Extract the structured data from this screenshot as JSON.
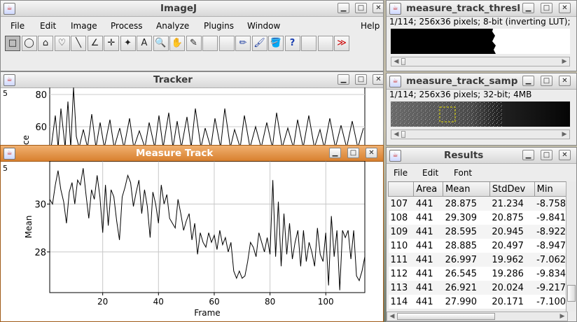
{
  "imagej": {
    "title": "ImageJ",
    "menus": [
      "File",
      "Edit",
      "Image",
      "Process",
      "Analyze",
      "Plugins",
      "Window",
      "Help"
    ],
    "tools": [
      "rectangle-tool",
      "oval-tool",
      "polygon-tool",
      "freehand-tool",
      "line-tool",
      "angle-tool",
      "point-tool",
      "wand-tool",
      "text-tool",
      "magnifier-tool",
      "hand-tool",
      "color-picker-tool",
      "",
      "",
      "pencil-tool",
      "brush-tool",
      "flood-fill-tool",
      "help-tool",
      "",
      "",
      "more-tools"
    ],
    "tool_glyphs": [
      "□",
      "◯",
      "⌂",
      "♡",
      "╲",
      "∠",
      "✛",
      "✦",
      "A",
      "🔍",
      "✋",
      "✎",
      "",
      "",
      "✏",
      "🖌",
      "🪣",
      "?",
      "",
      "",
      "≫"
    ]
  },
  "tracker": {
    "title": "Tracker",
    "ytick_labels": [
      "80",
      "60"
    ],
    "ylabel_fragment": "ce",
    "side_mark": "5"
  },
  "measure_track": {
    "title": "Measure Track",
    "side_mark": "5",
    "chart_data": {
      "type": "line",
      "title": "",
      "xlabel": "Frame",
      "ylabel": "Mean",
      "xlim": [
        1,
        114
      ],
      "ylim": [
        26.3,
        31.8
      ],
      "xticks": [
        20,
        40,
        60,
        80,
        100
      ],
      "yticks": [
        28,
        30
      ],
      "grid": true,
      "x": [
        1,
        2,
        3,
        4,
        5,
        6,
        7,
        8,
        9,
        10,
        11,
        12,
        13,
        14,
        15,
        16,
        17,
        18,
        19,
        20,
        21,
        22,
        23,
        24,
        25,
        26,
        27,
        28,
        29,
        30,
        31,
        32,
        33,
        34,
        35,
        36,
        37,
        38,
        39,
        40,
        41,
        42,
        43,
        44,
        45,
        46,
        47,
        48,
        49,
        50,
        51,
        52,
        53,
        54,
        55,
        56,
        57,
        58,
        59,
        60,
        61,
        62,
        63,
        64,
        65,
        66,
        67,
        68,
        69,
        70,
        71,
        72,
        73,
        74,
        75,
        76,
        77,
        78,
        79,
        80,
        81,
        82,
        83,
        84,
        85,
        86,
        87,
        88,
        89,
        90,
        91,
        92,
        93,
        94,
        95,
        96,
        97,
        98,
        99,
        100,
        101,
        102,
        103,
        104,
        105,
        106,
        107,
        108,
        109,
        110,
        111,
        112,
        113,
        114
      ],
      "y": [
        30.2,
        30.0,
        30.8,
        31.4,
        30.6,
        30.1,
        29.2,
        30.5,
        30.9,
        30.0,
        31.0,
        30.8,
        31.5,
        30.4,
        29.4,
        30.6,
        30.2,
        31.2,
        30.3,
        28.8,
        30.8,
        29.1,
        30.6,
        30.3,
        29.3,
        28.5,
        30.3,
        30.7,
        31.2,
        30.9,
        29.9,
        30.5,
        31.0,
        29.6,
        30.6,
        29.9,
        28.6,
        30.5,
        30.0,
        29.2,
        30.8,
        30.0,
        30.4,
        29.4,
        29.2,
        29.0,
        30.2,
        29.6,
        28.9,
        29.3,
        29.6,
        28.5,
        29.2,
        27.9,
        28.8,
        28.4,
        28.2,
        28.8,
        28.4,
        28.7,
        28.1,
        28.9,
        28.3,
        28.6,
        28.0,
        28.4,
        27.2,
        26.9,
        27.2,
        26.9,
        27.0,
        27.6,
        28.4,
        28.2,
        27.8,
        28.8,
        28.4,
        28.0,
        28.6,
        27.9,
        31.0,
        27.8,
        30.1,
        27.4,
        29.6,
        27.9,
        29.2,
        27.7,
        28.4,
        28.9,
        27.4,
        28.9,
        27.6,
        28.4,
        28.0,
        27.4,
        29.0,
        27.9,
        27.6,
        28.8,
        26.6,
        29.5,
        27.8,
        28.9,
        26.4,
        28.9,
        28.6,
        28.9,
        27.7,
        28.9,
        27.0,
        26.8,
        27.2,
        27.8
      ]
    }
  },
  "thresh_win": {
    "title": "measure_track_thresh",
    "info": "1/114; 256x36 pixels; 8-bit (inverting LUT);"
  },
  "samp_win": {
    "title": "measure_track_samp",
    "info": "1/114; 256x36 pixels; 32-bit; 4MB"
  },
  "results": {
    "title": "Results",
    "menus": [
      "File",
      "Edit",
      "Font"
    ],
    "columns": [
      "",
      "Area",
      "Mean",
      "StdDev",
      "Min"
    ],
    "rows": [
      [
        "107",
        "441",
        "28.875",
        "21.234",
        "-8.758"
      ],
      [
        "108",
        "441",
        "29.309",
        "20.875",
        "-9.841"
      ],
      [
        "109",
        "441",
        "28.595",
        "20.945",
        "-8.922"
      ],
      [
        "110",
        "441",
        "28.885",
        "20.497",
        "-8.947"
      ],
      [
        "111",
        "441",
        "26.997",
        "19.962",
        "-7.062"
      ],
      [
        "112",
        "441",
        "26.545",
        "19.286",
        "-9.834"
      ],
      [
        "113",
        "441",
        "26.921",
        "20.024",
        "-9.217"
      ],
      [
        "114",
        "441",
        "27.990",
        "20.171",
        "-7.100"
      ]
    ]
  }
}
